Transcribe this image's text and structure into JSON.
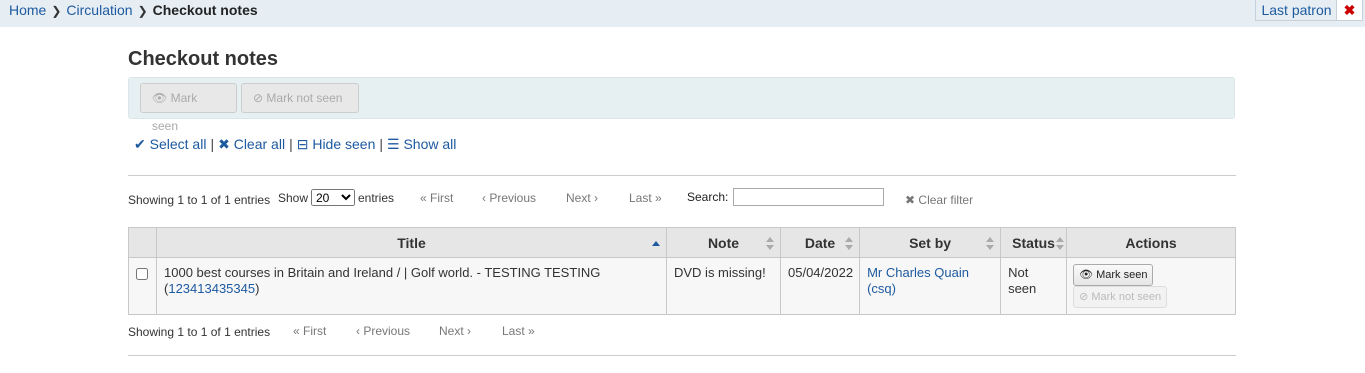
{
  "breadcrumb": {
    "home": "Home",
    "circulation": "Circulation",
    "current": "Checkout notes"
  },
  "patron": {
    "last_patron": "Last patron",
    "close": "✖"
  },
  "page_title": "Checkout notes",
  "toolbar": {
    "mark_seen": "Mark seen",
    "mark_not_seen": "Mark not seen"
  },
  "select_links": {
    "select_all": "Select all",
    "clear_all": "Clear all",
    "hide_seen": "Hide seen",
    "show_all": "Show all"
  },
  "datatable": {
    "info": "Showing 1 to 1 of 1 entries",
    "show_label": "Show",
    "entries_label": "entries",
    "length_value": "20",
    "first": "First",
    "previous": "Previous",
    "next": "Next",
    "last": "Last",
    "search_label": "Search:",
    "search_value": "",
    "clear_filter": "Clear filter"
  },
  "table": {
    "headers": {
      "title": "Title",
      "note": "Note",
      "date": "Date",
      "set_by": "Set by",
      "status": "Status",
      "actions": "Actions"
    },
    "rows": [
      {
        "title": "1000 best courses in Britain and Ireland / | Golf world. - TESTING TESTING",
        "barcode": "123413435345",
        "note": "DVD is missing!",
        "date": "05/04/2022",
        "set_by": "Mr Charles Quain (csq)",
        "status": "Not seen",
        "mark_seen": "Mark seen",
        "mark_not_seen": "Mark not seen"
      }
    ]
  }
}
